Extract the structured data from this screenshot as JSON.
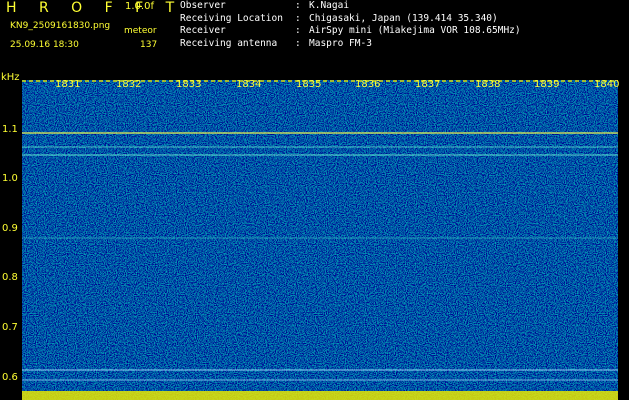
{
  "header": {
    "title": "H R O F F T",
    "version": "1.0.0f",
    "filename": "KN9_2509161830.png",
    "meteor_label": "meteor",
    "datetime": "25.09.16 18:30",
    "meteor_count": "137"
  },
  "info": [
    {
      "key": "Observer",
      "sep": ":",
      "value": "K.Nagai"
    },
    {
      "key": "Receiving Location",
      "sep": ":",
      "value": "Chigasaki, Japan (139.414 35.340)"
    },
    {
      "key": "Receiver",
      "sep": ":",
      "value": "AirSpy mini (Miakejima VOR 108.65MHz)"
    },
    {
      "key": "Receiving antenna",
      "sep": ":",
      "value": "Maspro FM-3"
    }
  ],
  "axis": {
    "unit": "kHz",
    "y_ticks": [
      "1.1",
      "1.0",
      "0.9",
      "0.8",
      "0.7",
      "0.6"
    ],
    "time_ticks": [
      "1831",
      "1832",
      "1833",
      "1834",
      "1835",
      "1836",
      "1837",
      "1838",
      "1839",
      "1840"
    ]
  },
  "colors": {
    "background": "#000000",
    "spectrogram_base": "#000c8c",
    "label_yellow": "#ffff33",
    "bottom_band_yellow": "#e8e800"
  }
}
